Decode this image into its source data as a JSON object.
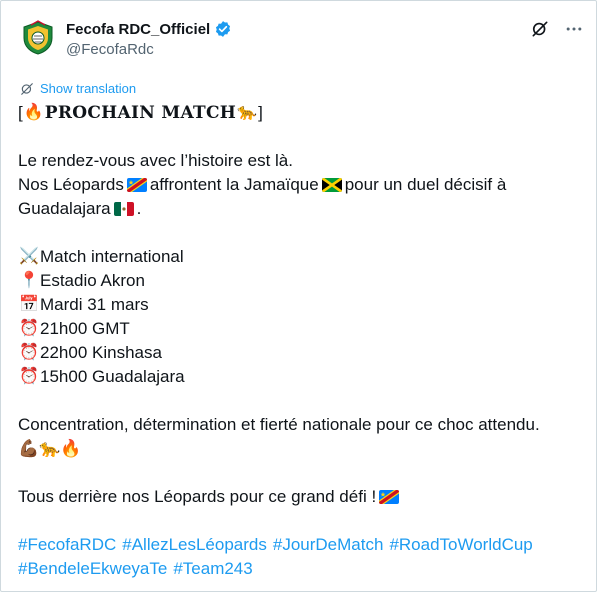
{
  "author": {
    "display_name": "Fecofa RDC_Officiel",
    "handle": "@FecofaRdc",
    "verified": true,
    "avatar_icon": "fecofa-crest-logo"
  },
  "header_actions": {
    "grok_icon": "grok-icon",
    "more_icon": "more-icon"
  },
  "translate": {
    "label": "Show translation",
    "icon": "translate-icon"
  },
  "post": {
    "title_open": "[",
    "title_emoji": "🔥",
    "title_text": "PROCHAIN MATCH",
    "title_emoji2": "🐆",
    "title_close": "]",
    "line1": "Le rendez-vous avec l’histoire est là.",
    "line2a": "Nos Léopards",
    "line2b": "affrontent la Jamaïque",
    "line2c": "pour un duel décisif à",
    "line3": "Guadalajara",
    "line3_end": ".",
    "details": [
      {
        "emoji": "⚔️",
        "text": "Match international"
      },
      {
        "emoji": "📍",
        "text": "Estadio Akron"
      },
      {
        "emoji": "📅",
        "text": "Mardi 31 mars"
      },
      {
        "emoji": "⏰",
        "text": "21h00 GMT"
      },
      {
        "emoji": "⏰",
        "text": "22h00 Kinshasa"
      },
      {
        "emoji": "⏰",
        "text": "15h00 Guadalajara"
      }
    ],
    "closing": "Concentration, détermination et fierté nationale pour ce choc attendu.",
    "closing_emojis": "💪🏾🐆🔥",
    "final_line": "Tous derrière nos Léopards pour ce grand défi !",
    "hashtags_line1": [
      "#FecofaRDC",
      "#AllezLesLéopards",
      "#JourDeMatch",
      "#RoadToWorldCup"
    ],
    "hashtags_line2": [
      "#BendeleEkweyaTe",
      "#Team243"
    ]
  },
  "colors": {
    "link": "#1d9bf0",
    "text": "#0f1419",
    "muted": "#536471",
    "verified": "#1d9bf0"
  }
}
